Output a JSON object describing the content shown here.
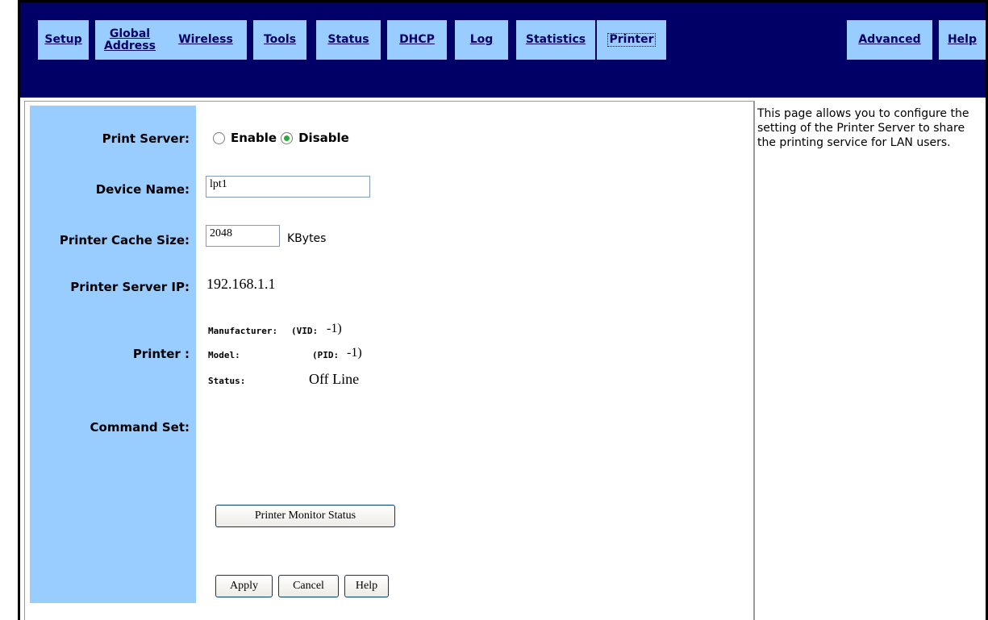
{
  "nav": {
    "tabs": [
      {
        "label": "Setup"
      },
      {
        "label": "Global Address"
      },
      {
        "label": "Wireless"
      },
      {
        "label": "Tools"
      },
      {
        "label": "Status"
      },
      {
        "label": "DHCP"
      },
      {
        "label": "Log"
      },
      {
        "label": "Statistics"
      },
      {
        "label": "Printer"
      },
      {
        "label": "Advanced"
      },
      {
        "label": "Help"
      }
    ],
    "global_line1": "Global",
    "global_line2": "Address"
  },
  "colors": {
    "nav_bg": "#000066",
    "tab_bg": "#99ccff",
    "sidebar_bg": "#99ccff",
    "radio_selected": "#2fa73a"
  },
  "form": {
    "print_server_label": "Print Server:",
    "enable_label": "Enable",
    "disable_label": "Disable",
    "print_server_selected": "Disable",
    "device_name_label": "Device Name:",
    "device_name_value": "lpt1",
    "cache_size_label": "Printer Cache Size:",
    "cache_size_value": "2048",
    "cache_size_unit": "KBytes",
    "server_ip_label": "Printer Server IP:",
    "server_ip_value": "192.168.1.1",
    "printer_label": "Printer :",
    "manufacturer_label": "Manufacturer:",
    "vid_label": "(VID:",
    "vid_value": "-1)",
    "model_label": "Model:",
    "pid_label": "(PID:",
    "pid_value": "-1)",
    "status_label": "Status:",
    "status_value": "Off Line",
    "command_set_label": "Command Set:"
  },
  "buttons": {
    "monitor": "Printer Monitor Status",
    "apply": "Apply",
    "cancel": "Cancel",
    "help": "Help"
  },
  "help_panel": {
    "text": "This page allows you to configure the setting of the Printer Server to share the printing service for LAN users."
  }
}
